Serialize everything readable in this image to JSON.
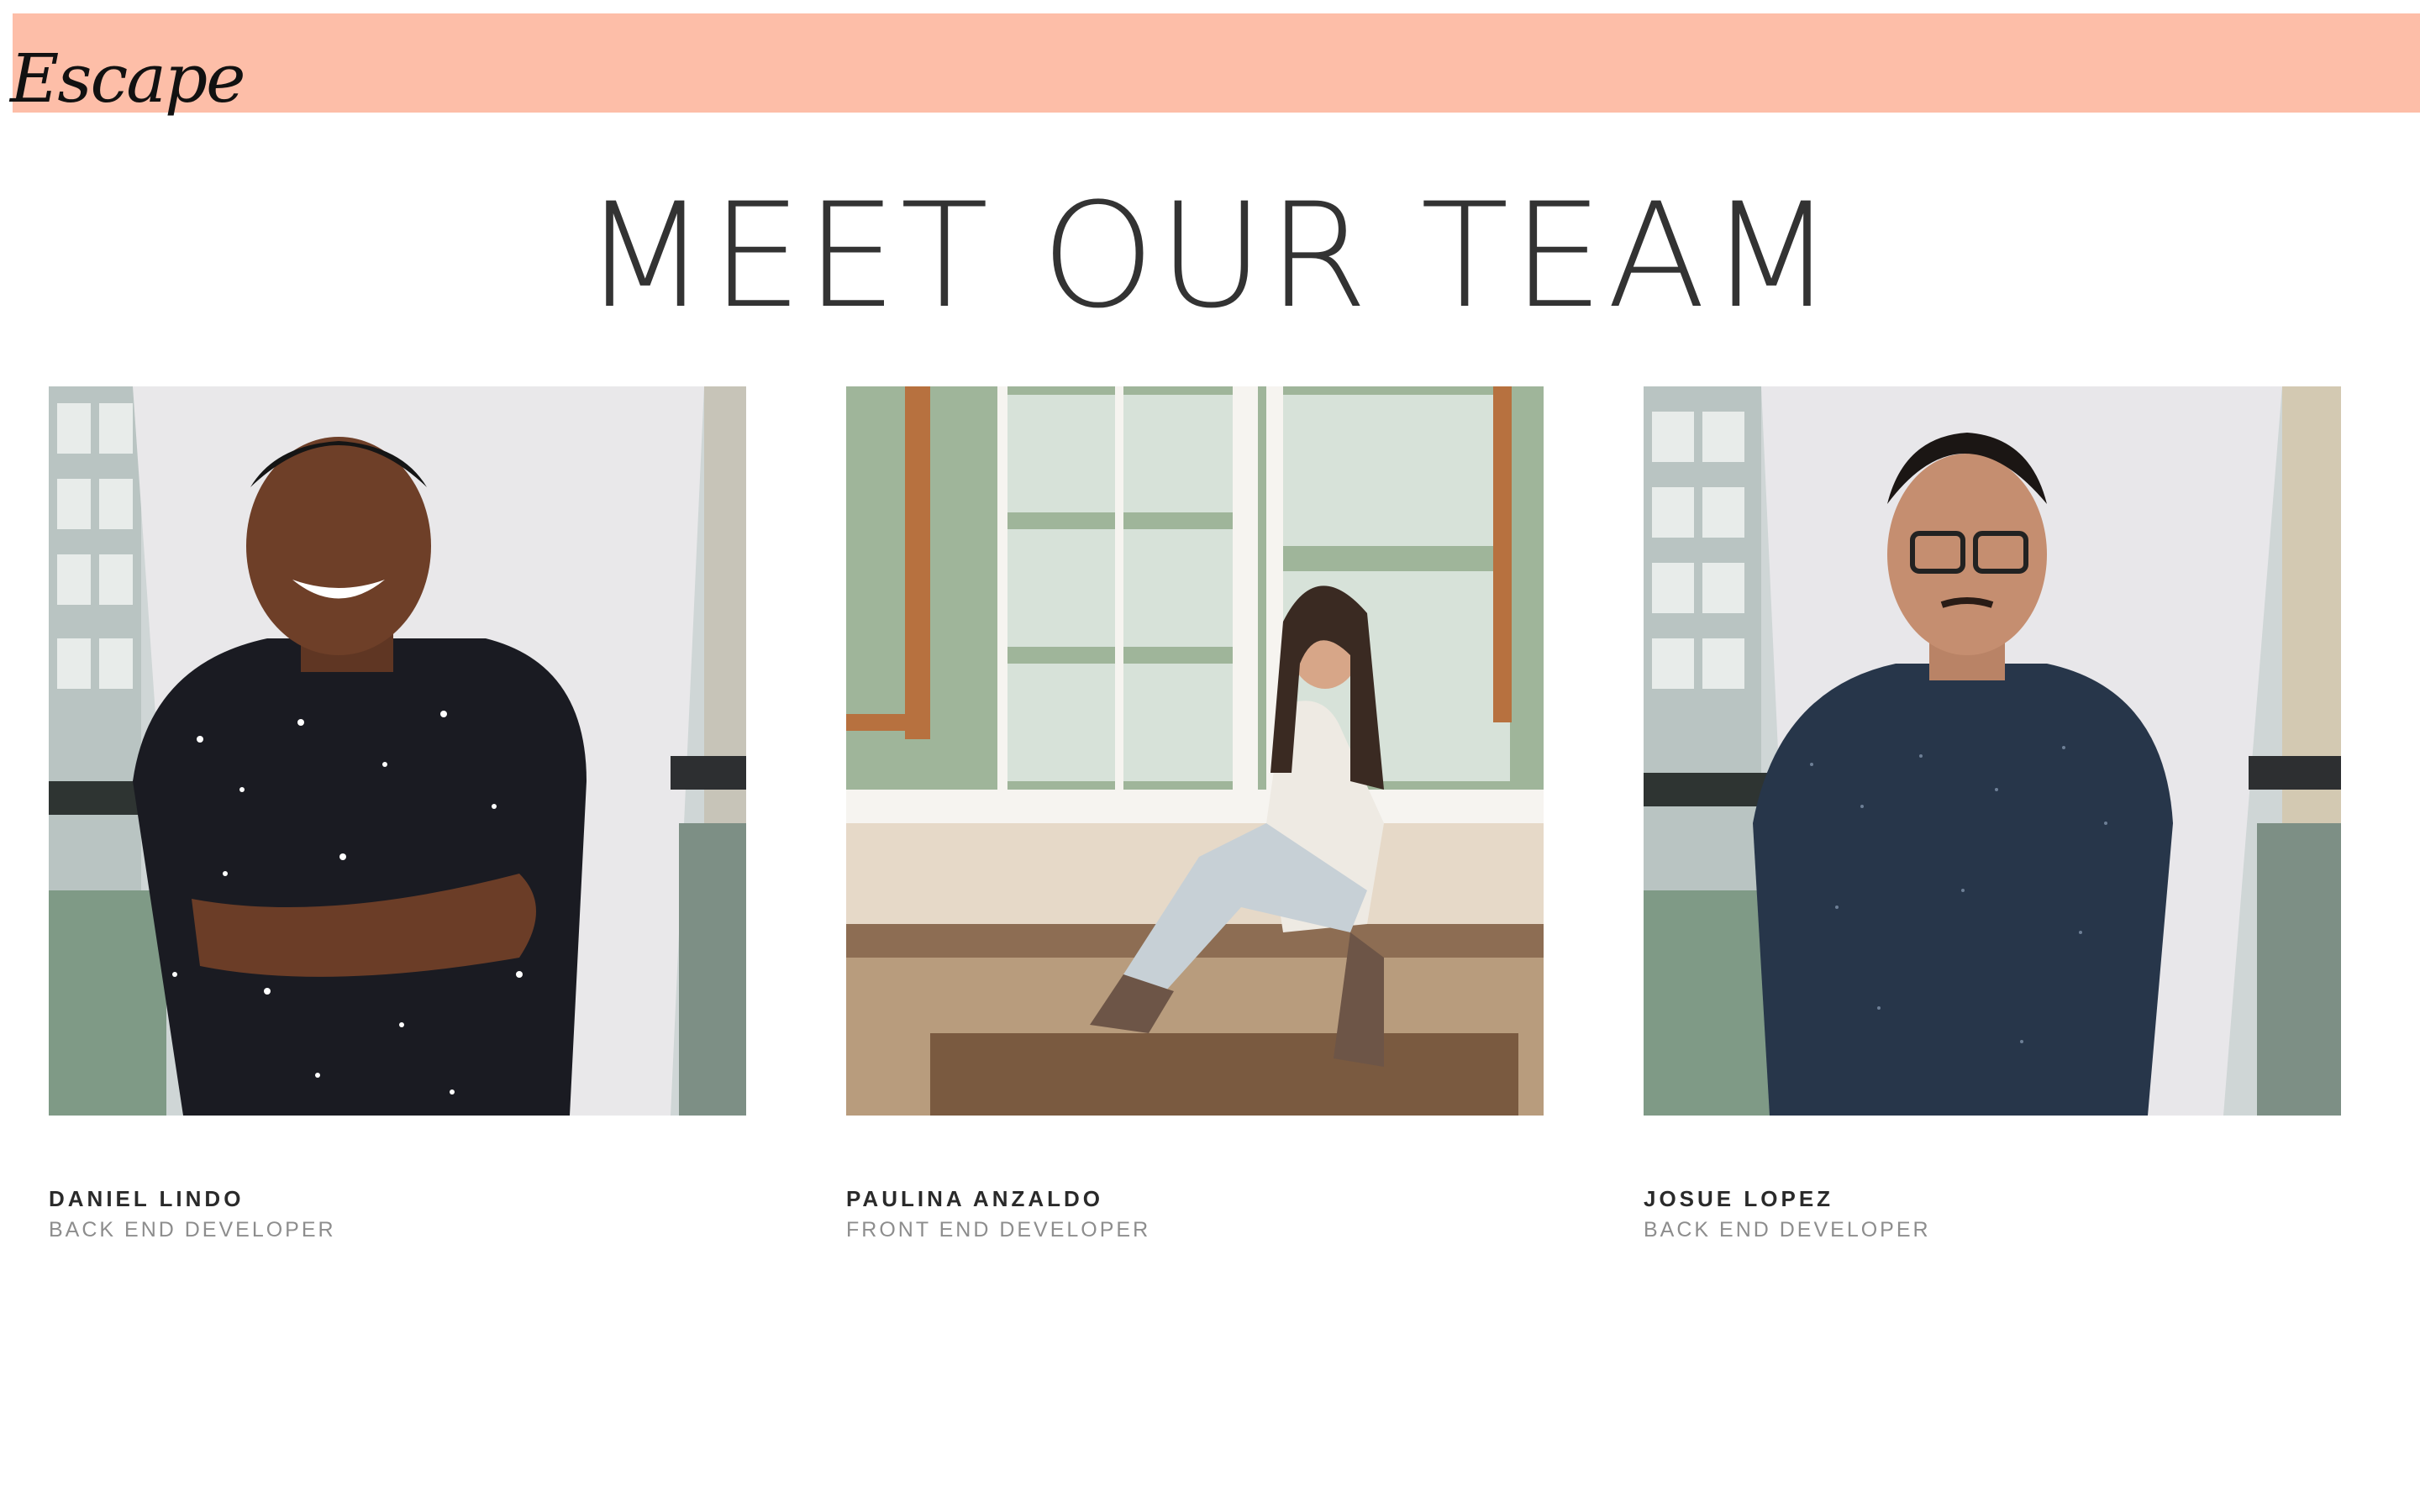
{
  "header": {
    "logo_text": "Escape",
    "background_color": "#fdbea8"
  },
  "main": {
    "title": "MEET OUR TEAM"
  },
  "team": [
    {
      "name": "DANIEL LINDO",
      "role": "BACK END DEVELOPER",
      "photo_icon": "portrait-photo"
    },
    {
      "name": "PAULINA ANZALDO",
      "role": "FRONT END DEVELOPER",
      "photo_icon": "portrait-photo"
    },
    {
      "name": "JOSUE LOPEZ",
      "role": "BACK END DEVELOPER",
      "photo_icon": "portrait-photo"
    }
  ]
}
